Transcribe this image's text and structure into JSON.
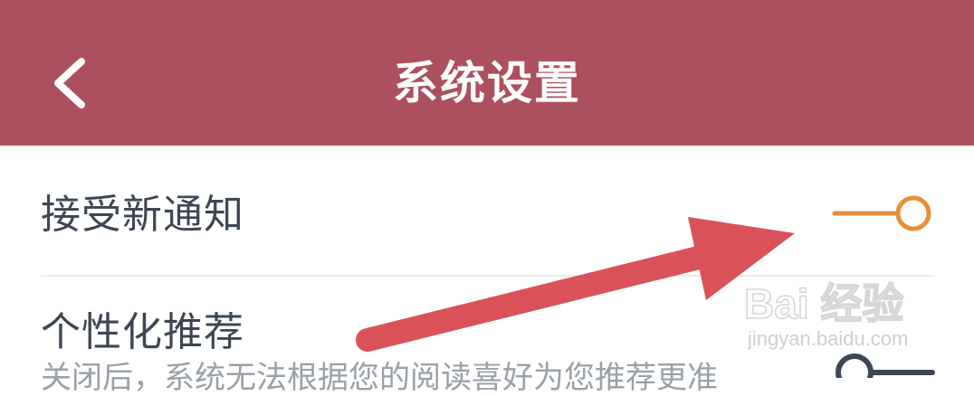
{
  "header": {
    "title": "系统设置",
    "back_icon": "chevron-left-icon",
    "background_color": "#ad505d"
  },
  "settings": [
    {
      "label": "接受新通知",
      "toggle_on": true,
      "toggle_color": "#e5903a"
    },
    {
      "label": "个性化推荐",
      "description": "关闭后，系统无法根据您的阅读喜好为您推荐更准",
      "toggle_on": false,
      "toggle_color": "#3d4653"
    }
  ],
  "annotation": {
    "arrow_color": "#d9525a"
  },
  "watermark": {
    "logo_text": "Bai 经验",
    "url": "jingyan.baidu.com"
  }
}
